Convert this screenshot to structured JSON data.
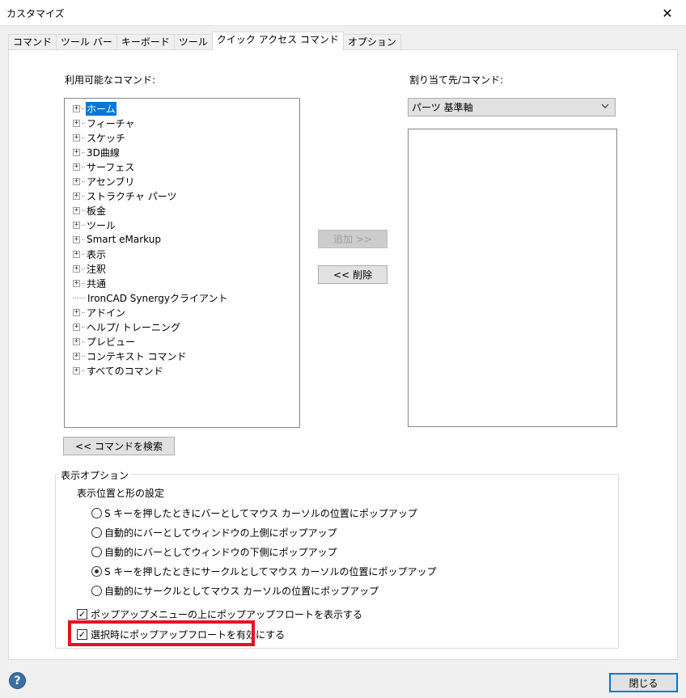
{
  "window": {
    "title": "カスタマイズ",
    "close_glyph": "✕"
  },
  "tabs": [
    {
      "label": "コマンド"
    },
    {
      "label": "ツール バー"
    },
    {
      "label": "キーボード"
    },
    {
      "label": "ツール"
    },
    {
      "label": "クイック アクセス コマンド",
      "active": true
    },
    {
      "label": "オプション"
    }
  ],
  "left": {
    "label": "利用可能なコマンド:",
    "tree": [
      {
        "label": "ホーム",
        "selected": true,
        "expandable": true
      },
      {
        "label": "フィーチャ",
        "expandable": true
      },
      {
        "label": "スケッチ",
        "expandable": true
      },
      {
        "label": "3D曲線",
        "expandable": true
      },
      {
        "label": "サーフェス",
        "expandable": true
      },
      {
        "label": "アセンブリ",
        "expandable": true
      },
      {
        "label": "ストラクチャ パーツ",
        "expandable": true
      },
      {
        "label": "板金",
        "expandable": true
      },
      {
        "label": "ツール",
        "expandable": true
      },
      {
        "label": "Smart eMarkup",
        "expandable": true
      },
      {
        "label": "表示",
        "expandable": true
      },
      {
        "label": "注釈",
        "expandable": true
      },
      {
        "label": "共通",
        "expandable": true
      },
      {
        "label": "IronCAD Synergyクライアント",
        "expandable": false
      },
      {
        "label": "アドイン",
        "expandable": true
      },
      {
        "label": "ヘルプ/ トレーニング",
        "expandable": true
      },
      {
        "label": "プレビュー",
        "expandable": true
      },
      {
        "label": "コンテキスト コマンド",
        "expandable": true
      },
      {
        "label": "すべてのコマンド",
        "expandable": true
      }
    ],
    "search_button": "<< コマンドを検索"
  },
  "middle": {
    "add_button": "追加 >>",
    "remove_button": "<< 削除"
  },
  "right": {
    "label": "割り当て先/コマンド:",
    "dropdown_value": "パーツ 基準軸"
  },
  "display_options": {
    "group_title": "表示オプション",
    "subtitle": "表示位置と形の設定",
    "radios": [
      {
        "label": "S キーを押したときにバーとしてマウス カーソルの位置にポップアップ",
        "checked": false
      },
      {
        "label": "自動的にバーとしてウィンドウの上側にポップアップ",
        "checked": false
      },
      {
        "label": "自動的にバーとしてウィンドウの下側にポップアップ",
        "checked": false
      },
      {
        "label": "S キーを押したときにサークルとしてマウス カーソルの位置にポップアップ",
        "checked": true
      },
      {
        "label": "自動的にサークルとしてマウス カーソルの位置にポップアップ",
        "checked": false
      }
    ],
    "checkboxes": [
      {
        "label": "ポップアップメニューの上にポップアップフロートを表示する",
        "checked": true
      },
      {
        "label": "選択時にポップアップフロートを有効にする",
        "checked": true
      }
    ],
    "highlight_color": "#e81123"
  },
  "footer": {
    "help_glyph": "?",
    "close_button": "閉じる"
  }
}
